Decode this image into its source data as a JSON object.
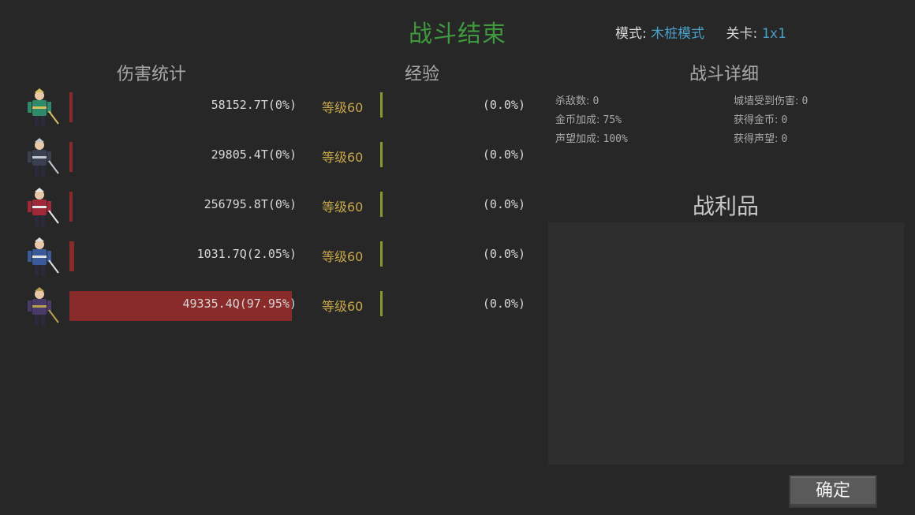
{
  "header": {
    "title": "战斗结束",
    "mode_label": "模式:",
    "mode_value": "木桩模式",
    "stage_label": "关卡:",
    "stage_value": "1x1"
  },
  "sections": {
    "damage_title": "伤害统计",
    "exp_title": "经验",
    "detail_title": "战斗详细",
    "loot_title": "战利品"
  },
  "heroes": [
    {
      "name": "archer-hero",
      "damage": "58152.7T(0%)",
      "share": 0.0,
      "level": "等级60",
      "exp": "(0.0%)",
      "colors": {
        "main": "#2f8a6a",
        "accent": "#d8c060"
      }
    },
    {
      "name": "swordsman-hero",
      "damage": "29805.4T(0%)",
      "share": 0.0,
      "level": "等级60",
      "exp": "(0.0%)",
      "colors": {
        "main": "#3a4050",
        "accent": "#c0c8d0"
      }
    },
    {
      "name": "mage-hero",
      "damage": "256795.8T(0%)",
      "share": 0.0,
      "level": "等级60",
      "exp": "(0.0%)",
      "colors": {
        "main": "#a02838",
        "accent": "#e8e8e8"
      }
    },
    {
      "name": "knight-hero",
      "damage": "1031.7Q(2.05%)",
      "share": 0.0205,
      "level": "等级60",
      "exp": "(0.0%)",
      "colors": {
        "main": "#3a5a9a",
        "accent": "#e0e0e0"
      }
    },
    {
      "name": "warlock-hero",
      "damage": "49335.4Q(97.95%)",
      "share": 0.9795,
      "level": "等级60",
      "exp": "(0.0%)",
      "colors": {
        "main": "#4a3a6a",
        "accent": "#b8a050"
      }
    }
  ],
  "details": {
    "kills_label": "杀敌数:",
    "kills": "0",
    "wall_damage_label": "城墙受到伤害:",
    "wall_damage": "0",
    "gold_bonus_label": "金币加成:",
    "gold_bonus": "75%",
    "gold_gained_label": "获得金币:",
    "gold_gained": "0",
    "fame_bonus_label": "声望加成:",
    "fame_bonus": "100%",
    "fame_gained_label": "获得声望:",
    "fame_gained": "0"
  },
  "confirm_label": "确定",
  "colors": {
    "title": "#3f9a3f",
    "accent_blue": "#4aa0c8",
    "damage_bar": "#8a2b2b",
    "level_text": "#c8a84a",
    "exp_bar": "#8a9a2a"
  }
}
